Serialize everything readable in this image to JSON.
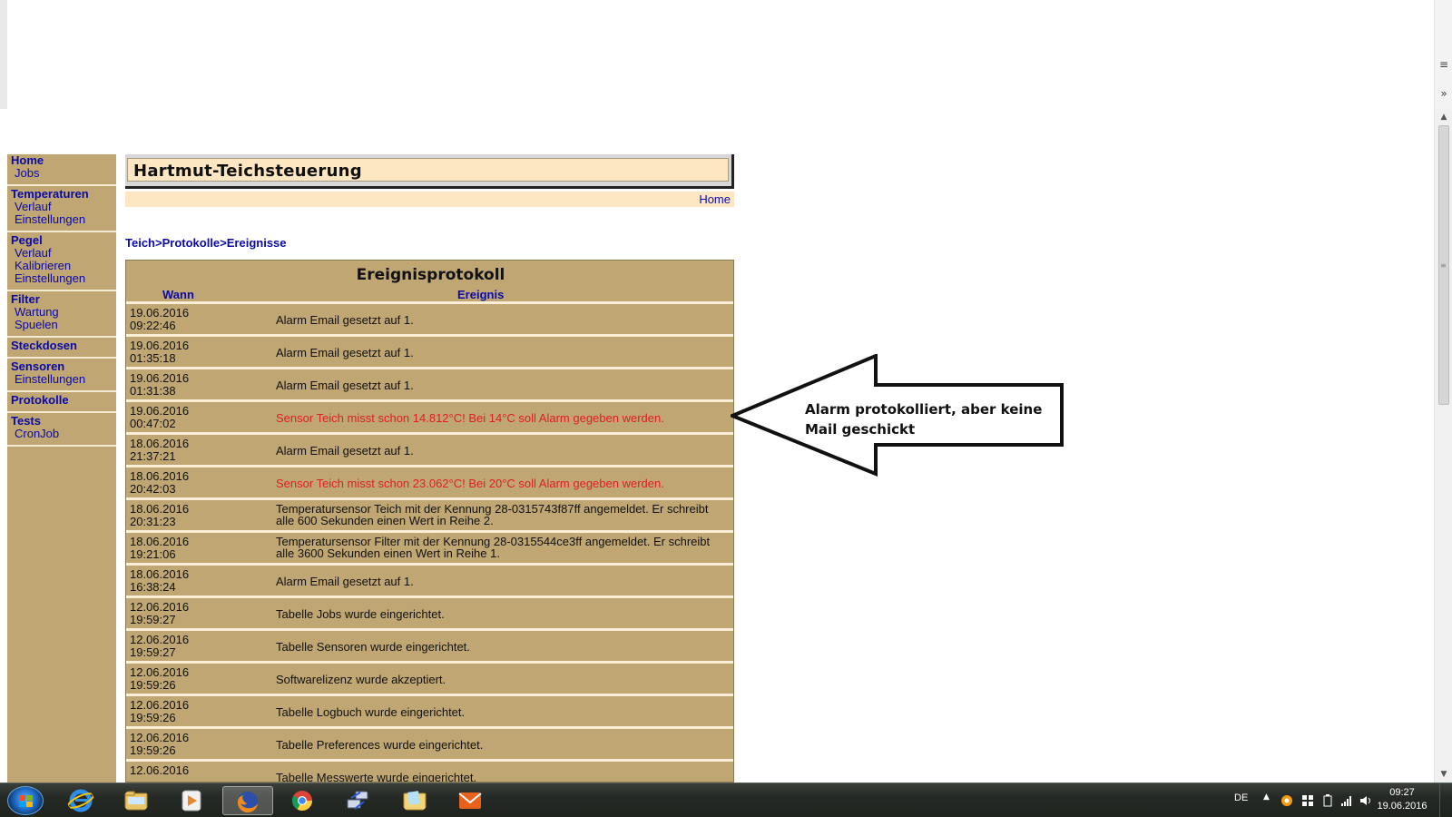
{
  "page": {
    "title": "Hartmut-Teichsteuerung",
    "home_link": "Home"
  },
  "nav": [
    {
      "label": "Home",
      "items": [
        "Jobs"
      ]
    },
    {
      "label": "Temperaturen",
      "items": [
        "Verlauf",
        "Einstellungen"
      ]
    },
    {
      "label": "Pegel",
      "items": [
        "Verlauf",
        "Kalibrieren",
        "Einstellungen"
      ]
    },
    {
      "label": "Filter",
      "items": [
        "Wartung",
        "Spuelen"
      ]
    },
    {
      "label": "Steckdosen",
      "items": []
    },
    {
      "label": "Sensoren",
      "items": [
        "Einstellungen"
      ]
    },
    {
      "label": "Protokolle",
      "items": []
    },
    {
      "label": "Tests",
      "items": [
        "CronJob"
      ]
    }
  ],
  "breadcrumb": [
    "Teich",
    "Protokolle",
    "Ereignisse"
  ],
  "breadcrumb_sep": ">",
  "log": {
    "title": "Ereignisprotokoll",
    "col_when": "Wann",
    "col_event": "Ereignis",
    "rows": [
      {
        "date": "19.06.2016",
        "time": "09:22:46",
        "msg": "Alarm Email gesetzt auf 1.",
        "alert": false
      },
      {
        "date": "19.06.2016",
        "time": "01:35:18",
        "msg": "Alarm Email gesetzt auf 1.",
        "alert": false
      },
      {
        "date": "19.06.2016",
        "time": "01:31:38",
        "msg": "Alarm Email gesetzt auf 1.",
        "alert": false
      },
      {
        "date": "19.06.2016",
        "time": "00:47:02",
        "msg": "Sensor Teich misst schon 14.812°C! Bei 14°C soll Alarm gegeben werden.",
        "alert": true
      },
      {
        "date": "18.06.2016",
        "time": "21:37:21",
        "msg": "Alarm Email gesetzt auf 1.",
        "alert": false
      },
      {
        "date": "18.06.2016",
        "time": "20:42:03",
        "msg": "Sensor Teich misst schon 23.062°C! Bei 20°C soll Alarm gegeben werden.",
        "alert": true
      },
      {
        "date": "18.06.2016",
        "time": "20:31:23",
        "msg": "Temperatursensor Teich mit der Kennung 28-0315743f87ff angemeldet. Er schreibt alle 600 Sekunden einen Wert in Reihe 2.",
        "alert": false,
        "two_lines": true
      },
      {
        "date": "18.06.2016",
        "time": "19:21:06",
        "msg": "Temperatursensor Filter mit der Kennung 28-0315544ce3ff angemeldet. Er schreibt alle 3600 Sekunden einen Wert in Reihe 1.",
        "alert": false,
        "two_lines": true
      },
      {
        "date": "18.06.2016",
        "time": "16:38:24",
        "msg": "Alarm Email gesetzt auf 1.",
        "alert": false
      },
      {
        "date": "12.06.2016",
        "time": "19:59:27",
        "msg": "Tabelle Jobs wurde eingerichtet.",
        "alert": false
      },
      {
        "date": "12.06.2016",
        "time": "19:59:27",
        "msg": "Tabelle Sensoren wurde eingerichtet.",
        "alert": false
      },
      {
        "date": "12.06.2016",
        "time": "19:59:26",
        "msg": "Softwarelizenz wurde akzeptiert.",
        "alert": false
      },
      {
        "date": "12.06.2016",
        "time": "19:59:26",
        "msg": "Tabelle Logbuch wurde eingerichtet.",
        "alert": false
      },
      {
        "date": "12.06.2016",
        "time": "19:59:26",
        "msg": "Tabelle Preferences wurde eingerichtet.",
        "alert": false
      },
      {
        "date": "12.06.2016",
        "time": "",
        "msg": "Tabelle Messwerte wurde eingerichtet.",
        "alert": false
      }
    ]
  },
  "annotation": {
    "text": "Alarm protokolliert, aber keine Mail geschickt"
  },
  "taskbar": {
    "apps": [
      "internet-explorer",
      "file-explorer",
      "media-player",
      "firefox",
      "chrome",
      "network-tool",
      "folder-app",
      "mail-app"
    ],
    "active_app": "firefox",
    "language": "DE",
    "time": "09:27",
    "date": "19.06.2016"
  },
  "colors": {
    "nav_bg": "#bfa673",
    "link": "#0a0aa8",
    "header_bg": "#fde7c3",
    "alert_text": "#e02020"
  }
}
